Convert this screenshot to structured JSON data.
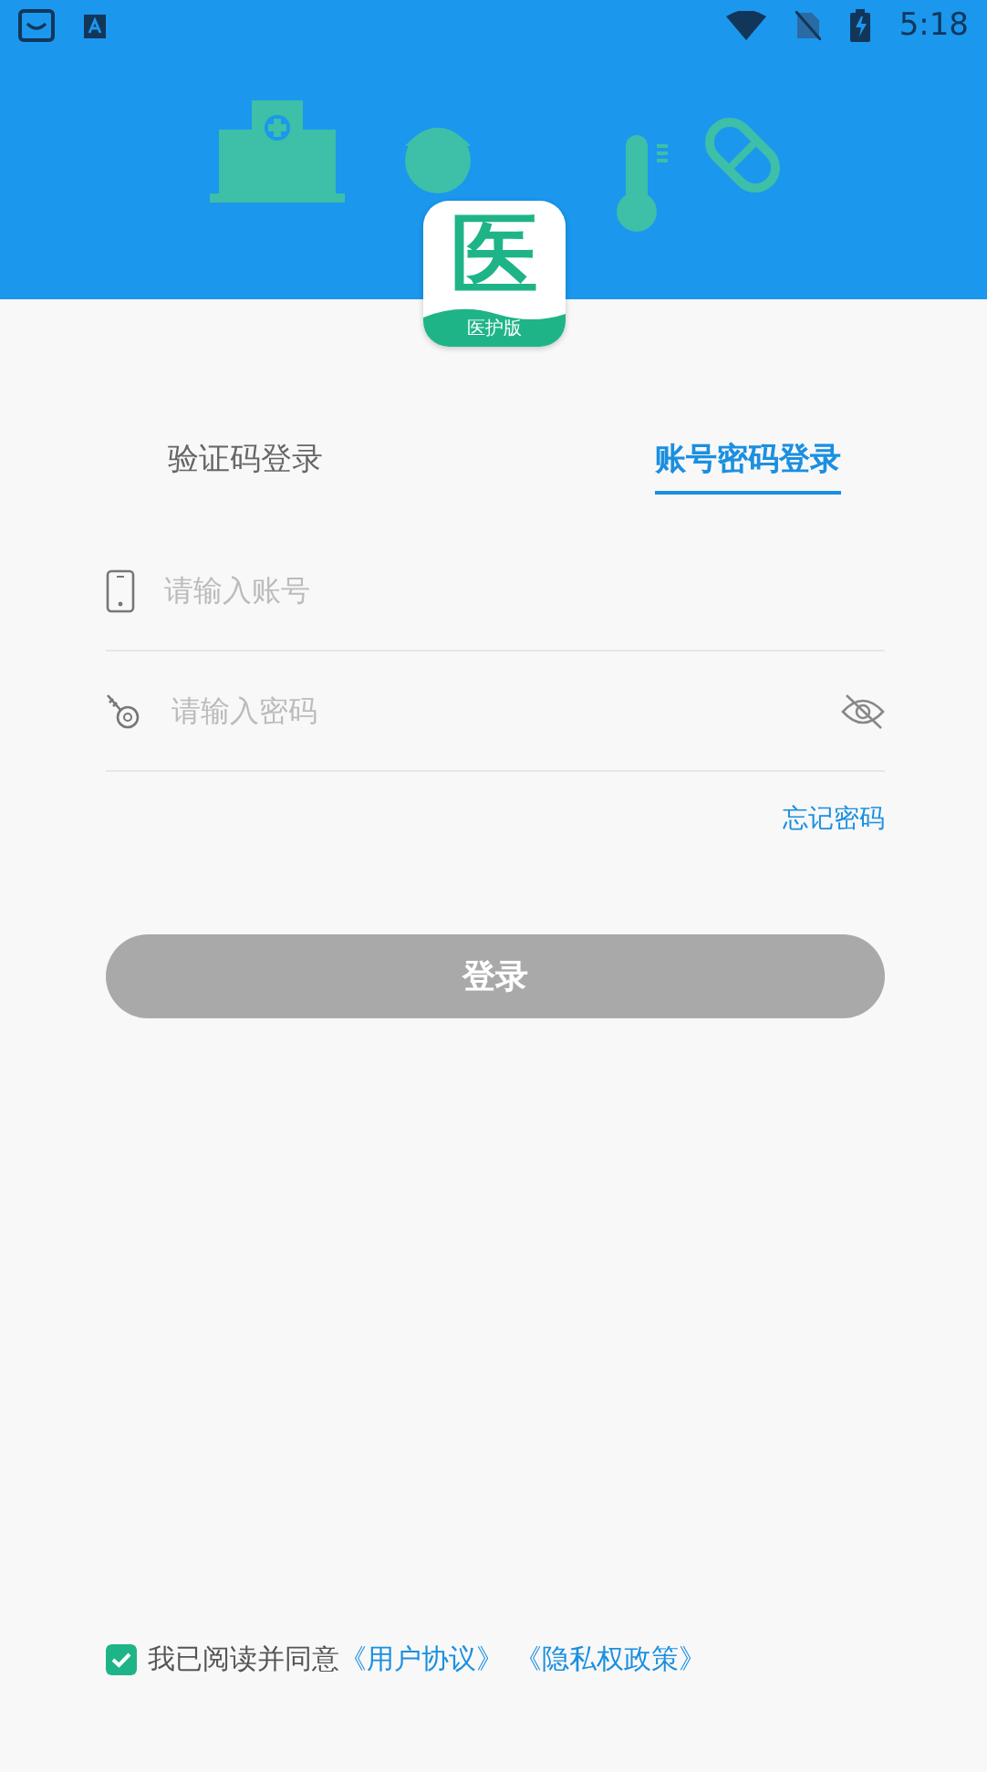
{
  "status_bar": {
    "time": "5:18"
  },
  "logo": {
    "glyph": "医",
    "badge": "医护版"
  },
  "tabs": [
    {
      "label": "验证码登录",
      "selected": false
    },
    {
      "label": "账号密码登录",
      "selected": true
    }
  ],
  "fields": [
    {
      "kind": "account",
      "placeholder": "请输入账号"
    },
    {
      "kind": "password",
      "placeholder": "请输入密码",
      "masked": true
    }
  ],
  "forgot_link": "忘记密码",
  "login_button": {
    "label": "登录",
    "disabled": true
  },
  "agreement": {
    "checked": true,
    "text": "我已阅读并同意",
    "links": [
      "《用户协议》",
      "《隐私权政策》"
    ]
  }
}
